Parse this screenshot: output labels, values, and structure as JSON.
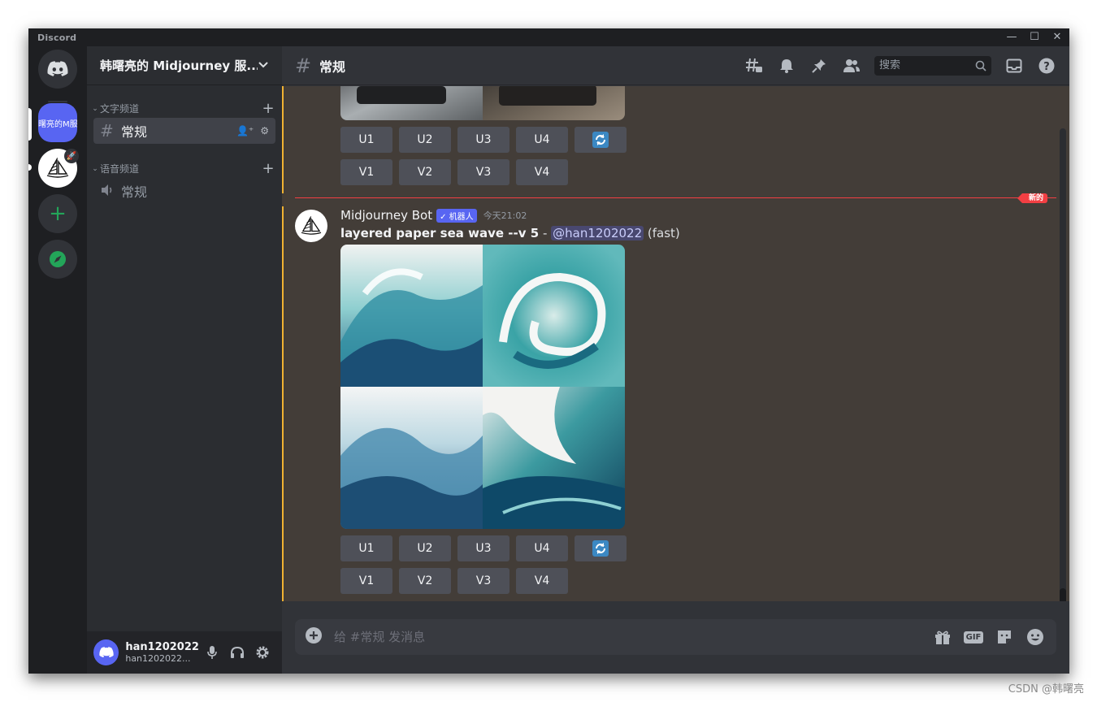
{
  "app": {
    "title": "Discord"
  },
  "window_controls": {
    "minimize": "—",
    "maximize": "☐",
    "close": "✕"
  },
  "servers": [
    {
      "name": "home",
      "icon": "discord-logo"
    },
    {
      "name": "韩曙亮的Midjourney服务器",
      "abbr": "曙亮的M服务",
      "active": true
    },
    {
      "name": "Midjourney",
      "icon": "sailboat"
    },
    {
      "name": "add-server",
      "icon": "plus"
    },
    {
      "name": "explore",
      "icon": "compass"
    }
  ],
  "guild": {
    "name": "韩曙亮的 Midjourney 服..."
  },
  "categories": {
    "text": {
      "label": "文字频道"
    },
    "voice": {
      "label": "语音频道"
    }
  },
  "channels": {
    "text_general": {
      "label": "常规"
    },
    "voice_general": {
      "label": "常规"
    }
  },
  "user": {
    "name": "han1202022",
    "tag": "han1202022..."
  },
  "topbar": {
    "channel": "常规",
    "search_placeholder": "搜索"
  },
  "message": {
    "author": "Midjourney Bot",
    "badge": "✓ 机器人",
    "timestamp": "今天21:02",
    "prompt": "layered paper sea wave --v 5",
    "separator": " - ",
    "mention": "@han1202022",
    "mode": " (fast)"
  },
  "buttons": {
    "upscale": [
      "U1",
      "U2",
      "U3",
      "U4"
    ],
    "variation": [
      "V1",
      "V2",
      "V3",
      "V4"
    ]
  },
  "new_divider": {
    "label": "新的"
  },
  "composer": {
    "placeholder": "给 #常规 发消息",
    "gif_label": "GIF"
  },
  "watermark": "CSDN @韩曙亮",
  "colors": {
    "accent": "#5865f2",
    "highlight_bar": "#f0b232",
    "new_divider": "#f23f43",
    "online": "#23a559"
  }
}
